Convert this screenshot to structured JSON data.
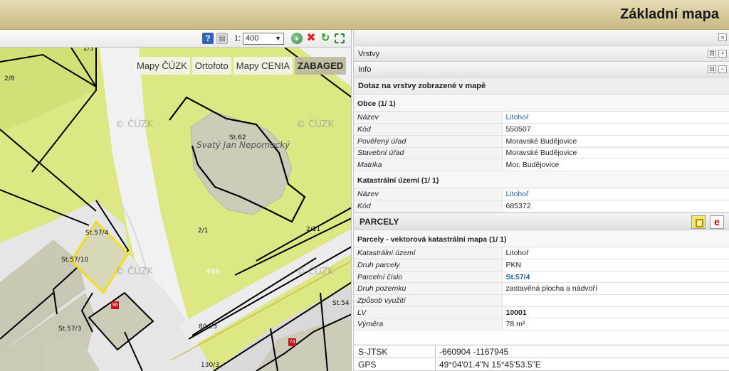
{
  "header": {
    "title": "Základní mapa"
  },
  "toolbar": {
    "help_icon": "help-icon",
    "print_icon": "printer-icon",
    "scale_prefix": "1:",
    "scale_value": "400",
    "globe_icon": "globe-icon",
    "clear_icon": "close-icon",
    "refresh_icon": "refresh-icon",
    "fullscreen_icon": "fullscreen-icon"
  },
  "map": {
    "layers": [
      {
        "label": "Mapy ČÚZK",
        "active": false
      },
      {
        "label": "Ortofoto",
        "active": false
      },
      {
        "label": "Mapy CENIA",
        "active": false
      },
      {
        "label": "ZABAGED",
        "active": true
      }
    ],
    "watermark": "© ČÚZK",
    "parcel_labels": [
      "2/3",
      "2/8",
      "St.62",
      "2/1",
      "2/11",
      "St.57/4",
      "St.57/10",
      "St.57/3",
      "804/3",
      "St.54",
      "130/3",
      "496"
    ],
    "church_name": "Svatý Jan Nepomucký",
    "badges": [
      "96",
      "74"
    ],
    "colors": {
      "grass": "#dde784",
      "road": "#eeeeee",
      "building": "#cdccb8",
      "boundary": "#000000",
      "highlight": "#f2e100"
    }
  },
  "panel": {
    "collapse_icon": "double-chevron-right-icon",
    "vrstvy_label": "Vrstvy",
    "info_label": "Info",
    "query_title": "Dotaz na vrstvy zobrazené v mapě",
    "obce": {
      "title": "Obce (1/ 1)",
      "rows": [
        {
          "k": "Název",
          "v": "Litohoř",
          "link": true
        },
        {
          "k": "Kód",
          "v": "550507"
        },
        {
          "k": "Pověřený úřad",
          "v": "Moravské Budějovice"
        },
        {
          "k": "Stavební úřad",
          "v": "Moravské Budějovice"
        },
        {
          "k": "Matrika",
          "v": "Mor. Budějovice"
        }
      ]
    },
    "ku": {
      "title": "Katastrální území (1/ 1)",
      "rows": [
        {
          "k": "Název",
          "v": "Litohoř",
          "link": true
        },
        {
          "k": "Kód",
          "v": "685372"
        }
      ]
    },
    "parcely_label": "PARCELY",
    "parcely": {
      "title": "Parcely - vektorová katastrální mapa (1/ 1)",
      "rows": [
        {
          "k": "Katastrální území",
          "v": "Litohoř"
        },
        {
          "k": "Druh parcely",
          "v": "PKN"
        },
        {
          "k": "Parcelní číslo",
          "v": "St.57/4",
          "boldlink": true
        },
        {
          "k": "Druh pozemku",
          "v": "zastavěná plocha a nádvoří"
        },
        {
          "k": "Způsob využití",
          "v": ""
        },
        {
          "k": "LV",
          "v": "10001",
          "bold": true
        },
        {
          "k": "Výměra",
          "v": "78 m²"
        }
      ]
    },
    "coords": [
      {
        "k": "S-JTSK",
        "v": "-660904 -1167945"
      },
      {
        "k": "GPS",
        "v": "49°04'01.4\"N 15°45'53.5\"E"
      }
    ]
  }
}
